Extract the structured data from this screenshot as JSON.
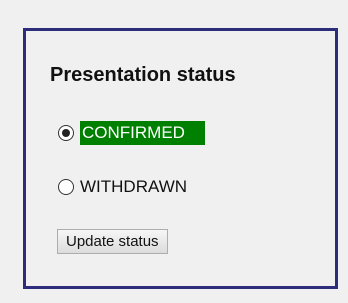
{
  "panel": {
    "title": "Presentation status",
    "border_color": "#2e2d7c"
  },
  "status_options": [
    {
      "label": "CONFIRMED",
      "selected": true,
      "highlight_color": "#008000"
    },
    {
      "label": "WITHDRAWN",
      "selected": false
    }
  ],
  "update_button": {
    "label": "Update status"
  }
}
